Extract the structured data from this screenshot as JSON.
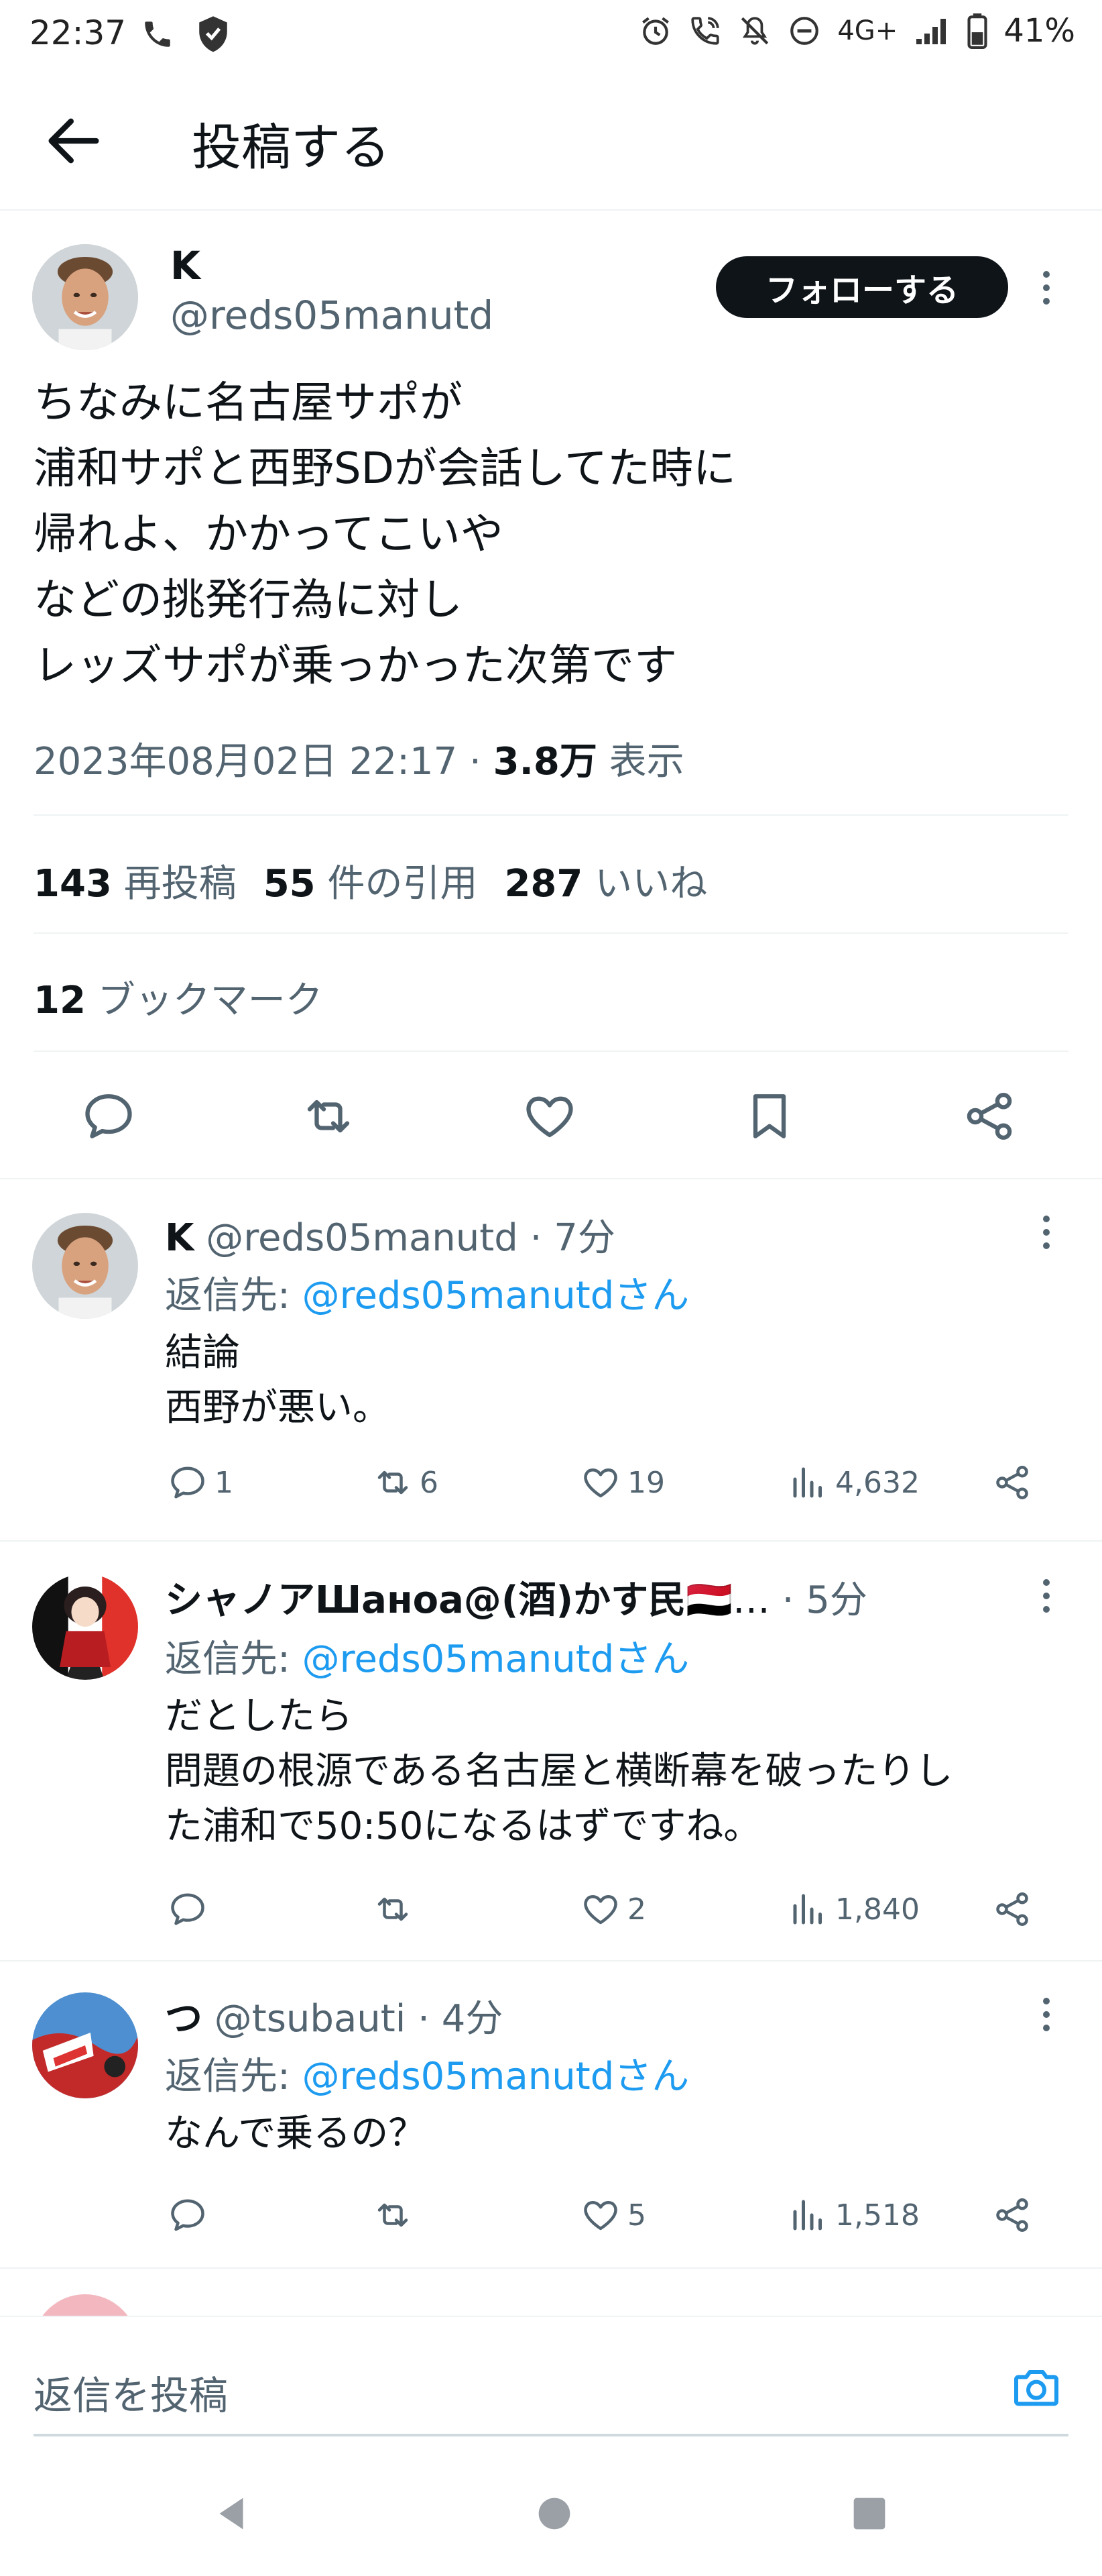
{
  "status_bar": {
    "time": "22:37",
    "network": "4G+",
    "battery": "41%"
  },
  "header": {
    "title": "投稿する"
  },
  "main_tweet": {
    "display_name": "K",
    "handle": "@reds05manutd",
    "follow_label": "フォローする",
    "body": "ちなみに名古屋サポが\n浦和サポと西野SDが会話してた時に\n帰れよ、かかってこいや\nなどの挑発行為に対し\nレッズサポが乗っかった次第です",
    "datetime": "2023年08月02日 22:17 · ",
    "views_count": "3.8万",
    "views_label": " 表示",
    "reposts_count": "143",
    "reposts_label": "再投稿",
    "quotes_count": "55",
    "quotes_label": "件の引用",
    "likes_count": "287",
    "likes_label": "いいね",
    "bookmarks_count": "12",
    "bookmarks_label": "ブックマーク"
  },
  "replies": [
    {
      "display_name": "K",
      "handle_time": " @reds05manutd · 7分",
      "reply_to_prefix": "返信先: ",
      "reply_to_user": "@reds05manutdさん",
      "text": "結論\n西野が悪い。",
      "replies": "1",
      "reposts": "6",
      "likes": "19",
      "views": "4,632"
    },
    {
      "display_name": "シャノアШанoa@(酒)かす民",
      "flag": "🇾🇪…",
      "time": " · 5分",
      "reply_to_prefix": "返信先: ",
      "reply_to_user": "@reds05manutdさん",
      "text": "だとしたら\n問題の根源である名古屋と横断幕を破ったりし\nた浦和で50:50になるはずですね。",
      "replies": "",
      "reposts": "",
      "likes": "2",
      "views": "1,840"
    },
    {
      "display_name": "つ",
      "handle_time": " @tsubauti · 4分",
      "reply_to_prefix": "返信先: ",
      "reply_to_user": "@reds05manutdさん",
      "text": "なんで乗るの？",
      "replies": "",
      "reposts": "",
      "likes": "5",
      "views": "1,518"
    }
  ],
  "composer": {
    "placeholder": "返信を投稿"
  },
  "colors": {
    "accent": "#1d9bf0",
    "text": "#0f1419",
    "secondary": "#536471",
    "divider": "#eff3f4"
  }
}
